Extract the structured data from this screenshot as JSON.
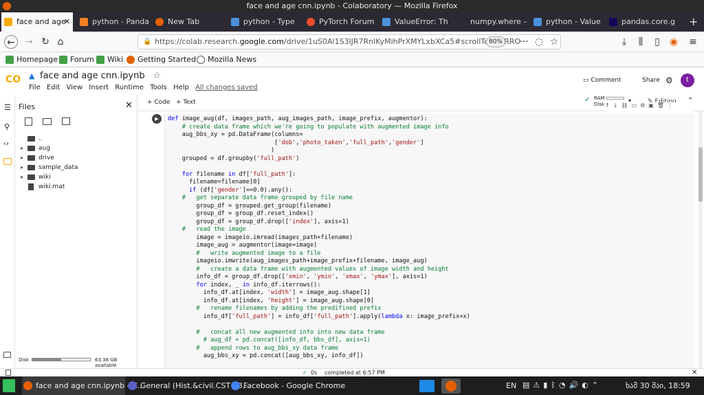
{
  "window": {
    "title": "face and age cnn.ipynb - Colaboratory — Mozilla Firefox"
  },
  "tabs": [
    {
      "label": "face and age",
      "color": "#f9ab00",
      "icon": "colab-icon"
    },
    {
      "label": "python - Panda",
      "color": "#f48024",
      "icon": "stackoverflow-icon"
    },
    {
      "label": "New Tab",
      "color": "#e66000",
      "icon": "firefox-icon"
    },
    {
      "label": "python - Type",
      "color": "#4a90d9",
      "icon": "python-docs-icon"
    },
    {
      "label": "PyTorch Forum",
      "color": "#ee4c2c",
      "icon": "pytorch-icon"
    },
    {
      "label": "ValueError: Th",
      "color": "#4a90d9",
      "icon": "github-icon"
    },
    {
      "label": "numpy.where —",
      "color": "#4a90d9",
      "icon": "numpy-icon"
    },
    {
      "label": "python - Value",
      "color": "#4a90d9",
      "icon": "python-docs-icon"
    },
    {
      "label": "pandas.core.g",
      "color": "#150458",
      "icon": "pandas-icon"
    }
  ],
  "nav": {
    "url_prefix": "https://colab.research.",
    "url_domain": "google.com",
    "url_suffix": "/drive/1uS0Al1S3lJR7RnlKyMihPrXMYLxbXCa5#scrollTo=cqRRO",
    "zoom": "80%"
  },
  "bookmarks": [
    {
      "label": "Homepage",
      "color": "#43a047"
    },
    {
      "label": "Forum",
      "color": "#43a047"
    },
    {
      "label": "Wiki",
      "color": "#43a047"
    },
    {
      "label": "Getting Started",
      "color": "#e66000"
    },
    {
      "label": "Mozilla News",
      "color": "#555555"
    }
  ],
  "colab": {
    "notebook_title": "face and age cnn.ipynb",
    "menus": [
      "File",
      "Edit",
      "View",
      "Insert",
      "Runtime",
      "Tools",
      "Help"
    ],
    "saved": "All changes saved",
    "comment": "Comment",
    "share": "Share",
    "avatar": "t",
    "add_code": "+ Code",
    "add_text": "+ Text",
    "ram": "RAM",
    "disk": "Disk",
    "editing": "Editing"
  },
  "files": {
    "title": "Files",
    "items": [
      {
        "name": "..",
        "kind": "folder",
        "expandable": false
      },
      {
        "name": "aug",
        "kind": "folder",
        "expandable": true
      },
      {
        "name": "drive",
        "kind": "folder",
        "expandable": true
      },
      {
        "name": "sample_data",
        "kind": "folder",
        "expandable": true
      },
      {
        "name": "wiki",
        "kind": "folder",
        "expandable": true
      },
      {
        "name": "wiki.mat",
        "kind": "file",
        "expandable": false
      }
    ],
    "disk_label": "Disk",
    "disk_available": "63.38 GB available",
    "disk_used_fraction": 0.5
  },
  "code_lines": [
    "def image_aug(df, images_path, aug_images_path, image_prefix, augmentor):",
    "    # create data frame which we're going to populate with augmented image info",
    "    aug_bbs_xy = pd.DataFrame(columns=",
    "                              ['dob','photo_taken','full_path','gender']",
    "                             )",
    "    grouped = df.groupby('full_path')",
    "",
    "    for filename in df['full_path']:",
    "      filename=filename[0]",
    "      if (df['gender']==0.0).any():",
    "    #   get separate data frame grouped by file name",
    "        group_df = grouped.get_group(filename)",
    "        group_df = group_df.reset_index()",
    "        group_df = group_df.drop(['index'], axis=1)",
    "    #   read the image",
    "        image = imageio.imread(images_path+filename)",
    "        image_aug = augmentor(image=image)",
    "        #   write augmented image to a file",
    "        imageio.imwrite(aug_images_path+image_prefix+filename, image_aug)",
    "        #   create a data frame with augmented values of image width and height",
    "        info_df = group_df.drop(['xmin', 'ymin', 'xmax', 'ymax'], axis=1)",
    "        for index, _ in info_df.iterrows():",
    "          info_df.at[index, 'width'] = image_aug.shape[1]",
    "          info_df.at[index, 'height'] = image_aug.shape[0]",
    "        #   rename filenames by adding the predifined prefix",
    "          info_df['full_path'] = info_df['full_path'].apply(lambda x: image_prefix+x)",
    "",
    "        #   concat all new augmented info into new data frame",
    "          # aug_df = pd.concat([info_df, bbs_df], axis=1)",
    "        #   append rows to aug_bbs_xy data frame",
    "          aug_bbs_xy = pd.concat([aug_bbs_xy, info_df])"
  ],
  "status": {
    "time": "0s",
    "message": "completed at 6:57 PM"
  },
  "taskbar": {
    "items": [
      {
        "label": "face and age cnn.ipynb - C...",
        "color": "#e66000"
      },
      {
        "label": "General (Hist.&civil.CST 18...",
        "color": "#5b5fc7"
      },
      {
        "label": "Facebook - Google Chrome",
        "color": "#4285f4"
      }
    ],
    "lang": "EN",
    "clock": "ხამ 30 მაი, 18:59"
  }
}
